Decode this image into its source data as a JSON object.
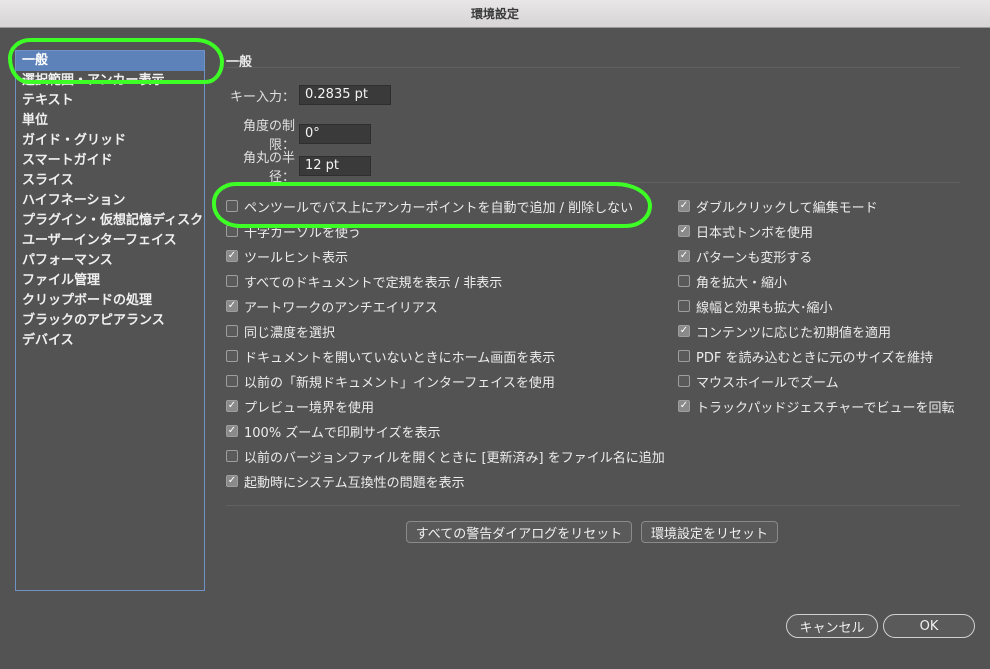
{
  "window": {
    "title": "環境設定"
  },
  "sidebar": {
    "items": [
      {
        "label": "一般",
        "selected": true
      },
      {
        "label": "選択範囲・アンカー表示"
      },
      {
        "label": "テキスト"
      },
      {
        "label": "単位"
      },
      {
        "label": "ガイド・グリッド"
      },
      {
        "label": "スマートガイド"
      },
      {
        "label": "スライス"
      },
      {
        "label": "ハイフネーション"
      },
      {
        "label": "プラグイン・仮想記憶ディスク"
      },
      {
        "label": "ユーザーインターフェイス"
      },
      {
        "label": "パフォーマンス"
      },
      {
        "label": "ファイル管理"
      },
      {
        "label": "クリップボードの処理"
      },
      {
        "label": "ブラックのアピアランス"
      },
      {
        "label": "デバイス"
      }
    ]
  },
  "section": {
    "title": "一般"
  },
  "fields": {
    "key_input": {
      "label": "キー入力：",
      "value": "0.2835 pt"
    },
    "angle_limit": {
      "label": "角度の制限：",
      "value": "0°"
    },
    "corner_radius": {
      "label": "角丸の半径：",
      "value": "12 pt"
    }
  },
  "options_left": [
    {
      "label": "ペンツールでパス上にアンカーポイントを自動で追加 / 削除しない",
      "checked": false
    },
    {
      "label": "十字カーソルを使う",
      "checked": false
    },
    {
      "label": "ツールヒント表示",
      "checked": true
    },
    {
      "label": "すべてのドキュメントで定規を表示 / 非表示",
      "checked": false
    },
    {
      "label": "アートワークのアンチエイリアス",
      "checked": true
    },
    {
      "label": "同じ濃度を選択",
      "checked": false
    },
    {
      "label": "ドキュメントを開いていないときにホーム画面を表示",
      "checked": false
    },
    {
      "label": "以前の「新規ドキュメント」インターフェイスを使用",
      "checked": false
    },
    {
      "label": "プレビュー境界を使用",
      "checked": true
    },
    {
      "label": "100% ズームで印刷サイズを表示",
      "checked": true
    },
    {
      "label": "以前のバージョンファイルを開くときに [更新済み] をファイル名に追加",
      "checked": false
    },
    {
      "label": "起動時にシステム互換性の問題を表示",
      "checked": true
    }
  ],
  "options_right": [
    {
      "label": "ダブルクリックして編集モード",
      "checked": true
    },
    {
      "label": "日本式トンボを使用",
      "checked": true
    },
    {
      "label": "パターンも変形する",
      "checked": true
    },
    {
      "label": "角を拡大・縮小",
      "checked": false
    },
    {
      "label": "線幅と効果も拡大･縮小",
      "checked": false
    },
    {
      "label": "コンテンツに応じた初期値を適用",
      "checked": true
    },
    {
      "label": "PDF を読み込むときに元のサイズを維持",
      "checked": false
    },
    {
      "label": "マウスホイールでズーム",
      "checked": false
    },
    {
      "label": "トラックパッドジェスチャーでビューを回転",
      "checked": true
    }
  ],
  "buttons": {
    "reset_warnings": "すべての警告ダイアログをリセット",
    "reset_prefs": "環境設定をリセット",
    "cancel": "キャンセル",
    "ok": "OK"
  },
  "icons": {
    "check": "checkmark-icon"
  },
  "colors": {
    "highlight": "#3dff25",
    "selected": "#5d82b9",
    "background": "#535353"
  }
}
